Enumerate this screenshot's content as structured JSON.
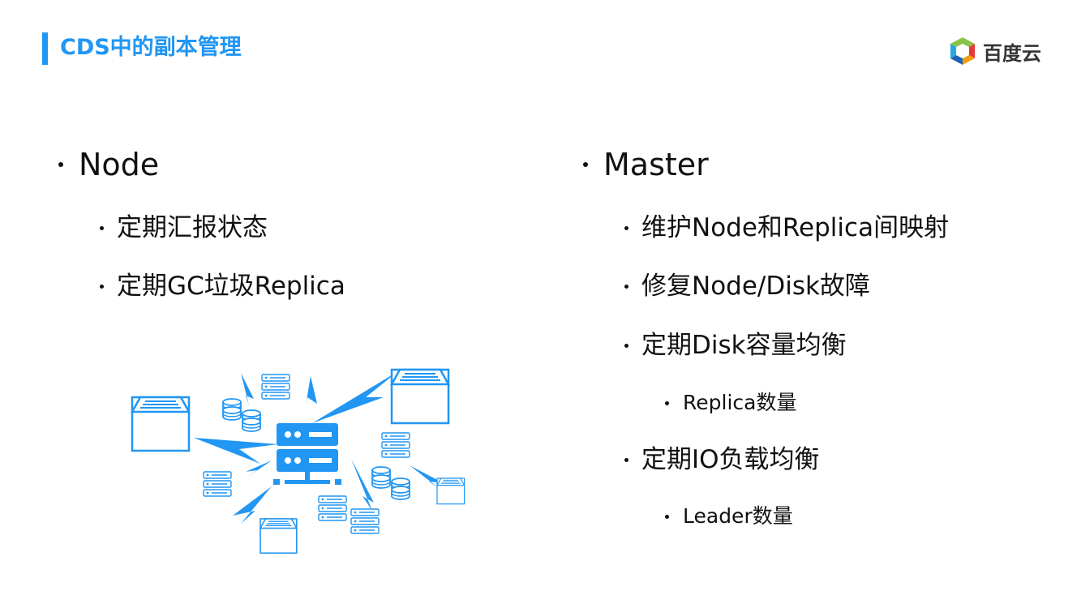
{
  "header": {
    "title": "CDS中的副本管理",
    "logo_text": "百度云",
    "accent_color": "#2196f3"
  },
  "left_column": {
    "heading": "Node",
    "items": [
      "定期汇报状态",
      "定期GC垃圾Replica"
    ],
    "illustration": "network-of-servers-illustration"
  },
  "right_column": {
    "heading": "Master",
    "items": [
      {
        "label": "维护Node和Replica间映射"
      },
      {
        "label": "修复Node/Disk故障"
      },
      {
        "label": "定期Disk容量均衡",
        "sub": "Replica数量"
      },
      {
        "label": "定期IO负载均衡",
        "sub": "Leader数量"
      }
    ]
  }
}
